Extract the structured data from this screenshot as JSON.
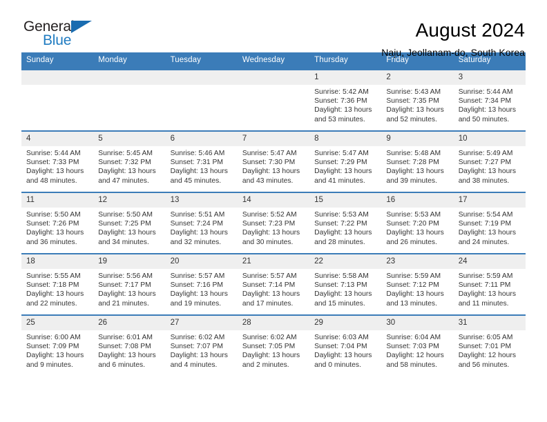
{
  "brand": {
    "word1": "General",
    "word2": "Blue",
    "triangle_color": "#1a6cb0",
    "word2_color": "#1f7bc1"
  },
  "header": {
    "title": "August 2024",
    "subtitle": "Naju, Jeollanam-do, South Korea",
    "accent_color": "#3b7cb8",
    "daynum_bg": "#efefef"
  },
  "weekdays": [
    "Sunday",
    "Monday",
    "Tuesday",
    "Wednesday",
    "Thursday",
    "Friday",
    "Saturday"
  ],
  "labels": {
    "sunrise": "Sunrise:",
    "sunset": "Sunset:",
    "daylight": "Daylight:"
  },
  "weeks": [
    [
      {
        "day": "",
        "lines": []
      },
      {
        "day": "",
        "lines": []
      },
      {
        "day": "",
        "lines": []
      },
      {
        "day": "",
        "lines": []
      },
      {
        "day": "1",
        "lines": [
          "Sunrise: 5:42 AM",
          "Sunset: 7:36 PM",
          "Daylight: 13 hours",
          "and 53 minutes."
        ]
      },
      {
        "day": "2",
        "lines": [
          "Sunrise: 5:43 AM",
          "Sunset: 7:35 PM",
          "Daylight: 13 hours",
          "and 52 minutes."
        ]
      },
      {
        "day": "3",
        "lines": [
          "Sunrise: 5:44 AM",
          "Sunset: 7:34 PM",
          "Daylight: 13 hours",
          "and 50 minutes."
        ]
      }
    ],
    [
      {
        "day": "4",
        "lines": [
          "Sunrise: 5:44 AM",
          "Sunset: 7:33 PM",
          "Daylight: 13 hours",
          "and 48 minutes."
        ]
      },
      {
        "day": "5",
        "lines": [
          "Sunrise: 5:45 AM",
          "Sunset: 7:32 PM",
          "Daylight: 13 hours",
          "and 47 minutes."
        ]
      },
      {
        "day": "6",
        "lines": [
          "Sunrise: 5:46 AM",
          "Sunset: 7:31 PM",
          "Daylight: 13 hours",
          "and 45 minutes."
        ]
      },
      {
        "day": "7",
        "lines": [
          "Sunrise: 5:47 AM",
          "Sunset: 7:30 PM",
          "Daylight: 13 hours",
          "and 43 minutes."
        ]
      },
      {
        "day": "8",
        "lines": [
          "Sunrise: 5:47 AM",
          "Sunset: 7:29 PM",
          "Daylight: 13 hours",
          "and 41 minutes."
        ]
      },
      {
        "day": "9",
        "lines": [
          "Sunrise: 5:48 AM",
          "Sunset: 7:28 PM",
          "Daylight: 13 hours",
          "and 39 minutes."
        ]
      },
      {
        "day": "10",
        "lines": [
          "Sunrise: 5:49 AM",
          "Sunset: 7:27 PM",
          "Daylight: 13 hours",
          "and 38 minutes."
        ]
      }
    ],
    [
      {
        "day": "11",
        "lines": [
          "Sunrise: 5:50 AM",
          "Sunset: 7:26 PM",
          "Daylight: 13 hours",
          "and 36 minutes."
        ]
      },
      {
        "day": "12",
        "lines": [
          "Sunrise: 5:50 AM",
          "Sunset: 7:25 PM",
          "Daylight: 13 hours",
          "and 34 minutes."
        ]
      },
      {
        "day": "13",
        "lines": [
          "Sunrise: 5:51 AM",
          "Sunset: 7:24 PM",
          "Daylight: 13 hours",
          "and 32 minutes."
        ]
      },
      {
        "day": "14",
        "lines": [
          "Sunrise: 5:52 AM",
          "Sunset: 7:23 PM",
          "Daylight: 13 hours",
          "and 30 minutes."
        ]
      },
      {
        "day": "15",
        "lines": [
          "Sunrise: 5:53 AM",
          "Sunset: 7:22 PM",
          "Daylight: 13 hours",
          "and 28 minutes."
        ]
      },
      {
        "day": "16",
        "lines": [
          "Sunrise: 5:53 AM",
          "Sunset: 7:20 PM",
          "Daylight: 13 hours",
          "and 26 minutes."
        ]
      },
      {
        "day": "17",
        "lines": [
          "Sunrise: 5:54 AM",
          "Sunset: 7:19 PM",
          "Daylight: 13 hours",
          "and 24 minutes."
        ]
      }
    ],
    [
      {
        "day": "18",
        "lines": [
          "Sunrise: 5:55 AM",
          "Sunset: 7:18 PM",
          "Daylight: 13 hours",
          "and 22 minutes."
        ]
      },
      {
        "day": "19",
        "lines": [
          "Sunrise: 5:56 AM",
          "Sunset: 7:17 PM",
          "Daylight: 13 hours",
          "and 21 minutes."
        ]
      },
      {
        "day": "20",
        "lines": [
          "Sunrise: 5:57 AM",
          "Sunset: 7:16 PM",
          "Daylight: 13 hours",
          "and 19 minutes."
        ]
      },
      {
        "day": "21",
        "lines": [
          "Sunrise: 5:57 AM",
          "Sunset: 7:14 PM",
          "Daylight: 13 hours",
          "and 17 minutes."
        ]
      },
      {
        "day": "22",
        "lines": [
          "Sunrise: 5:58 AM",
          "Sunset: 7:13 PM",
          "Daylight: 13 hours",
          "and 15 minutes."
        ]
      },
      {
        "day": "23",
        "lines": [
          "Sunrise: 5:59 AM",
          "Sunset: 7:12 PM",
          "Daylight: 13 hours",
          "and 13 minutes."
        ]
      },
      {
        "day": "24",
        "lines": [
          "Sunrise: 5:59 AM",
          "Sunset: 7:11 PM",
          "Daylight: 13 hours",
          "and 11 minutes."
        ]
      }
    ],
    [
      {
        "day": "25",
        "lines": [
          "Sunrise: 6:00 AM",
          "Sunset: 7:09 PM",
          "Daylight: 13 hours",
          "and 9 minutes."
        ]
      },
      {
        "day": "26",
        "lines": [
          "Sunrise: 6:01 AM",
          "Sunset: 7:08 PM",
          "Daylight: 13 hours",
          "and 6 minutes."
        ]
      },
      {
        "day": "27",
        "lines": [
          "Sunrise: 6:02 AM",
          "Sunset: 7:07 PM",
          "Daylight: 13 hours",
          "and 4 minutes."
        ]
      },
      {
        "day": "28",
        "lines": [
          "Sunrise: 6:02 AM",
          "Sunset: 7:05 PM",
          "Daylight: 13 hours",
          "and 2 minutes."
        ]
      },
      {
        "day": "29",
        "lines": [
          "Sunrise: 6:03 AM",
          "Sunset: 7:04 PM",
          "Daylight: 13 hours",
          "and 0 minutes."
        ]
      },
      {
        "day": "30",
        "lines": [
          "Sunrise: 6:04 AM",
          "Sunset: 7:03 PM",
          "Daylight: 12 hours",
          "and 58 minutes."
        ]
      },
      {
        "day": "31",
        "lines": [
          "Sunrise: 6:05 AM",
          "Sunset: 7:01 PM",
          "Daylight: 12 hours",
          "and 56 minutes."
        ]
      }
    ]
  ]
}
